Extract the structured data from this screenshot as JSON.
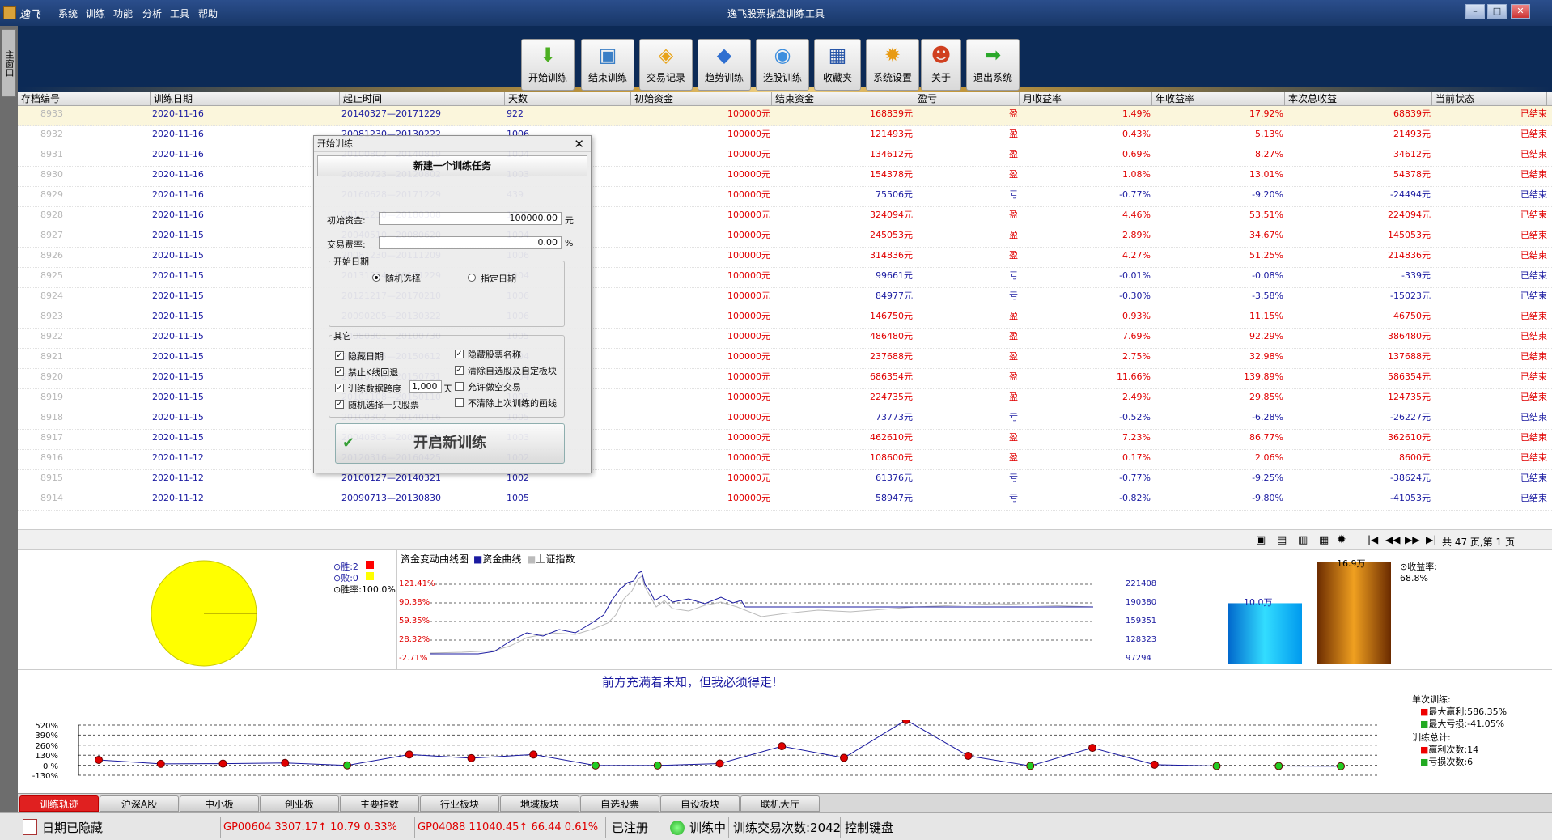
{
  "titlebar": {
    "logo_text": "逸飞",
    "window_title": "逸飞股票操盘训练工具",
    "menu": [
      "系统",
      "训练",
      "功能",
      "分析",
      "工具",
      "帮助"
    ],
    "min": "–",
    "max": "□",
    "close": "✕"
  },
  "side_tab": "主窗口",
  "toolbar": [
    {
      "label": "开始训练",
      "icon": "start-training-icon",
      "glyph": "⬇",
      "color": "#4caf22"
    },
    {
      "label": "结束训练",
      "icon": "end-training-icon",
      "glyph": "▣",
      "color": "#3b7fc6"
    },
    {
      "label": "交易记录",
      "icon": "trade-records-icon",
      "glyph": "◈",
      "color": "#e8a317"
    },
    {
      "label": "趋势训练",
      "icon": "trend-training-icon",
      "glyph": "◆",
      "color": "#2f6fd0"
    },
    {
      "label": "选股训练",
      "icon": "stock-pick-icon",
      "glyph": "◉",
      "color": "#3d8ede"
    },
    {
      "label": "收藏夹",
      "icon": "favorites-icon",
      "glyph": "▦",
      "color": "#2856a8"
    },
    {
      "label": "系统设置",
      "icon": "gear-icon",
      "glyph": "✹",
      "color": "#e89a12"
    },
    {
      "label": "关于",
      "icon": "about-icon",
      "glyph": "☻",
      "color": "#d04020"
    },
    {
      "label": "退出系统",
      "icon": "exit-arrow-icon",
      "glyph": "➡",
      "color": "#2aa82a"
    }
  ],
  "table": {
    "headers": [
      "存档编号",
      "训练日期",
      "起止时间",
      "天数",
      "初始资金",
      "结束资金",
      "盈亏",
      "月收益率",
      "年收益率",
      "本次总收益",
      "当前状态"
    ],
    "rows": [
      [
        "8933",
        "2020-11-16",
        "20140327—20171229",
        "922",
        "100000元",
        "168839元",
        "盈",
        "1.49%",
        "17.92%",
        "68839元",
        "已结束"
      ],
      [
        "8932",
        "2020-11-16",
        "20081230—20130222",
        "1006",
        "100000元",
        "121493元",
        "盈",
        "0.43%",
        "5.13%",
        "21493元",
        "已结束"
      ],
      [
        "8931",
        "2020-11-16",
        "20100802—20140819",
        "1004",
        "100000元",
        "134612元",
        "盈",
        "0.69%",
        "8.27%",
        "34612元",
        "已结束"
      ],
      [
        "8930",
        "2020-11-16",
        "20080723—20120802",
        "1003",
        "100000元",
        "154378元",
        "盈",
        "1.08%",
        "13.01%",
        "54378元",
        "已结束"
      ],
      [
        "8929",
        "2020-11-16",
        "20160628—20171229",
        "439",
        "100000元",
        "75506元",
        "亏",
        "-0.77%",
        "-9.20%",
        "-24494元",
        "已结束"
      ],
      [
        "8928",
        "2020-11-16",
        "20131230—20180308",
        "1005",
        "100000元",
        "324094元",
        "盈",
        "4.46%",
        "53.51%",
        "224094元",
        "已结束"
      ],
      [
        "8927",
        "2020-11-15",
        "20040510—20080620",
        "1004",
        "100000元",
        "245053元",
        "盈",
        "2.89%",
        "34.67%",
        "145053元",
        "已结束"
      ],
      [
        "8926",
        "2020-11-15",
        "20081230—20111209",
        "1006",
        "100000元",
        "314836元",
        "盈",
        "4.27%",
        "51.25%",
        "214836元",
        "已结束"
      ],
      [
        "8925",
        "2020-11-15",
        "20131224—20171229",
        "1004",
        "100000元",
        "99661元",
        "亏",
        "-0.01%",
        "-0.08%",
        "-339元",
        "已结束"
      ],
      [
        "8924",
        "2020-11-15",
        "20121217—20170210",
        "1006",
        "100000元",
        "84977元",
        "亏",
        "-0.30%",
        "-3.58%",
        "-15023元",
        "已结束"
      ],
      [
        "8923",
        "2020-11-15",
        "20090205—20130322",
        "1006",
        "100000元",
        "146750元",
        "盈",
        "0.93%",
        "11.15%",
        "46750元",
        "已结束"
      ],
      [
        "8922",
        "2020-11-15",
        "20080801—20100730",
        "1005",
        "100000元",
        "486480元",
        "盈",
        "7.69%",
        "92.29%",
        "386480元",
        "已结束"
      ],
      [
        "8921",
        "2020-11-15",
        "20110525—20150612",
        "1004",
        "100000元",
        "237688元",
        "盈",
        "2.75%",
        "32.98%",
        "137688元",
        "已结束"
      ],
      [
        "8920",
        "2020-11-15",
        "20110108—20150731",
        "1004",
        "100000元",
        "686354元",
        "盈",
        "11.66%",
        "139.89%",
        "586354元",
        "已结束"
      ],
      [
        "8919",
        "2020-11-15",
        "20101108—20150110",
        "1005",
        "100000元",
        "224735元",
        "盈",
        "2.49%",
        "29.85%",
        "124735元",
        "已结束"
      ],
      [
        "8918",
        "2020-11-15",
        "20100302—20140416",
        "1005",
        "100000元",
        "73773元",
        "亏",
        "-0.52%",
        "-6.28%",
        "-26227元",
        "已结束"
      ],
      [
        "8917",
        "2020-11-15",
        "20040803—20080820",
        "1003",
        "100000元",
        "462610元",
        "盈",
        "7.23%",
        "86.77%",
        "362610元",
        "已结束"
      ],
      [
        "8916",
        "2020-11-12",
        "20120316—20160425",
        "1002",
        "100000元",
        "108600元",
        "盈",
        "0.17%",
        "2.06%",
        "8600元",
        "已结束"
      ],
      [
        "8915",
        "2020-11-12",
        "20100127—20140321",
        "1002",
        "100000元",
        "61376元",
        "亏",
        "-0.77%",
        "-9.25%",
        "-38624元",
        "已结束"
      ],
      [
        "8914",
        "2020-11-12",
        "20090713—20130830",
        "1005",
        "100000元",
        "58947元",
        "亏",
        "-0.82%",
        "-9.80%",
        "-41053元",
        "已结束"
      ]
    ]
  },
  "pager": {
    "text": "共 47 页,第 1 页"
  },
  "pie": {
    "win_label": "⊙胜:2",
    "lose_label": "⊙败:0",
    "rate_label": "⊙胜率:100.0%",
    "win_color": "#ff0000",
    "lose_color": "#ffff00"
  },
  "equity": {
    "title": "资金变动曲线图",
    "legend_fund": "资金曲线",
    "legend_index": "上证指数",
    "left_ticks": [
      "121.41%",
      "90.38%",
      "59.35%",
      "28.32%",
      "-2.71%"
    ],
    "right_ticks": [
      "221408",
      "190380",
      "159351",
      "128323",
      "97294"
    ]
  },
  "bars": {
    "label_a": "10.0万",
    "label_b": "16.9万",
    "yield_label": "⊙收益率:",
    "yield_value": "68.8%",
    "value_a": 10.0,
    "value_b": 16.9
  },
  "motto": "前方充满着未知，但我必须得走!",
  "profit_chart": {
    "y_ticks": [
      "520%",
      "390%",
      "260%",
      "130%",
      "0 %",
      "-130%"
    ],
    "values": [
      69,
      18,
      21,
      30,
      -1,
      139,
      92,
      139,
      -3,
      -3,
      22,
      246,
      96,
      585,
      122,
      -8,
      225,
      8,
      -10,
      -10,
      -12
    ]
  },
  "summary": {
    "single": "单次训练:",
    "max_win": "最大赢利:586.35%",
    "max_loss": "最大亏损:-41.05%",
    "total": "训练总计:",
    "win_count": "赢利次数:14",
    "loss_count": "亏损次数:6"
  },
  "tabs": [
    "训练轨迹",
    "沪深A股",
    "中小板",
    "创业板",
    "主要指数",
    "行业板块",
    "地域板块",
    "自选股票",
    "自设板块",
    "联机大厅"
  ],
  "status": {
    "date_hidden": "日期已隐藏",
    "idx1": "GP00604 3307.17↑ 10.79 0.33%",
    "idx2": "GP04088 11040.45↑ 66.44 0.61%",
    "registered": "已注册",
    "training": "训练中",
    "trade_count": "训练交易次数:2042",
    "keyboard": "控制键盘"
  },
  "dialog": {
    "title": "开始训练",
    "close": "✕",
    "header": "新建一个训练任务",
    "init_capital_label": "初始资金:",
    "init_capital_value": "100000.00",
    "unit_yuan": "元",
    "fee_label": "交易费率:",
    "fee_value": "0.00",
    "unit_pct": "%",
    "start_date_group": "开始日期",
    "random_select": "随机选择",
    "specified_date": "指定日期",
    "other_group": "其它",
    "opt_hide_date": "隐藏日期",
    "opt_no_rewind": "禁止K线回退",
    "opt_span_label": "训练数据跨度",
    "opt_span_value": "1,000",
    "opt_span_unit": "天",
    "opt_random_one": "随机选择一只股票",
    "opt_hide_name": "隐藏股票名称",
    "opt_clear_sel": "清除自选股及自定板块",
    "opt_allow_short": "允许做空交易",
    "opt_keep_lines": "不清除上次训练的画线",
    "start_button": "开启新训练"
  }
}
